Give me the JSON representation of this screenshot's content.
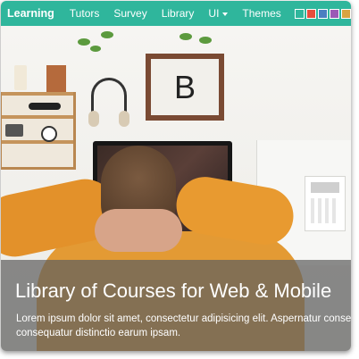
{
  "navbar": {
    "brand": "Learning",
    "links": [
      "Tutors",
      "Survey",
      "Library",
      "UI",
      "Themes"
    ],
    "swatch_colors": [
      "#2fb69c",
      "#e74c3c",
      "#4a7fc1",
      "#9b59b6",
      "#d9a441"
    ],
    "background_color": "#2fb69c"
  },
  "hero": {
    "frame_letter": "B",
    "title": "Library of Courses for Web & Mobile",
    "text_line1": "Lorem ipsum dolor sit amet, consectetur adipisicing elit. Aspernatur consecte",
    "text_line2": "consequatur distinctio earum ipsam."
  }
}
